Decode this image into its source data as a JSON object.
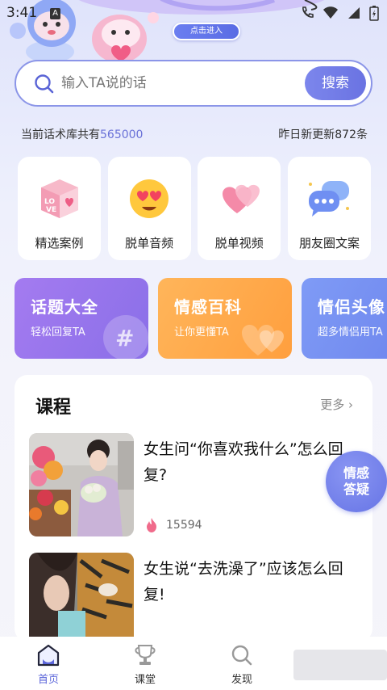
{
  "status_bar": {
    "time": "3:41",
    "notification_badge": "A"
  },
  "banner": {
    "cta_label": "点击进入"
  },
  "search": {
    "placeholder": "输入TA说的话",
    "button_label": "搜索"
  },
  "stats": {
    "left_prefix": "当前话术库共有",
    "left_count": "565000",
    "right_text": "昨日新更新872条"
  },
  "categories": [
    {
      "label": "精选案例",
      "icon": "love-cube-icon"
    },
    {
      "label": "脱单音频",
      "icon": "heart-eyes-emoji-icon"
    },
    {
      "label": "脱单视频",
      "icon": "hearts-icon"
    },
    {
      "label": "朋友圈文案",
      "icon": "chat-bubbles-icon"
    }
  ],
  "features": [
    {
      "title": "话题大全",
      "subtitle": "轻松回复TA",
      "icon": "hashtag-icon"
    },
    {
      "title": "情感百科",
      "subtitle": "让你更懂TA",
      "icon": "hearts-outline-icon"
    },
    {
      "title": "情侣头像",
      "subtitle": "超多情侣用TA",
      "icon": "avatar-icon"
    }
  ],
  "course": {
    "title": "课程",
    "more_label": "更多 ›",
    "items": [
      {
        "text": "女生问“你喜欢我什么”怎么回复?",
        "heat": "15594"
      },
      {
        "text": "女生说“去洗澡了”应该怎么回复!",
        "heat": ""
      }
    ]
  },
  "float_bubble": {
    "line1": "情感",
    "line2": "答疑"
  },
  "nav": {
    "home": "首页",
    "class": "课堂",
    "discover": "发现"
  },
  "colors": {
    "accent": "#6a72e0",
    "orange": "#ff9f3e",
    "purple": "#8f74ec"
  }
}
